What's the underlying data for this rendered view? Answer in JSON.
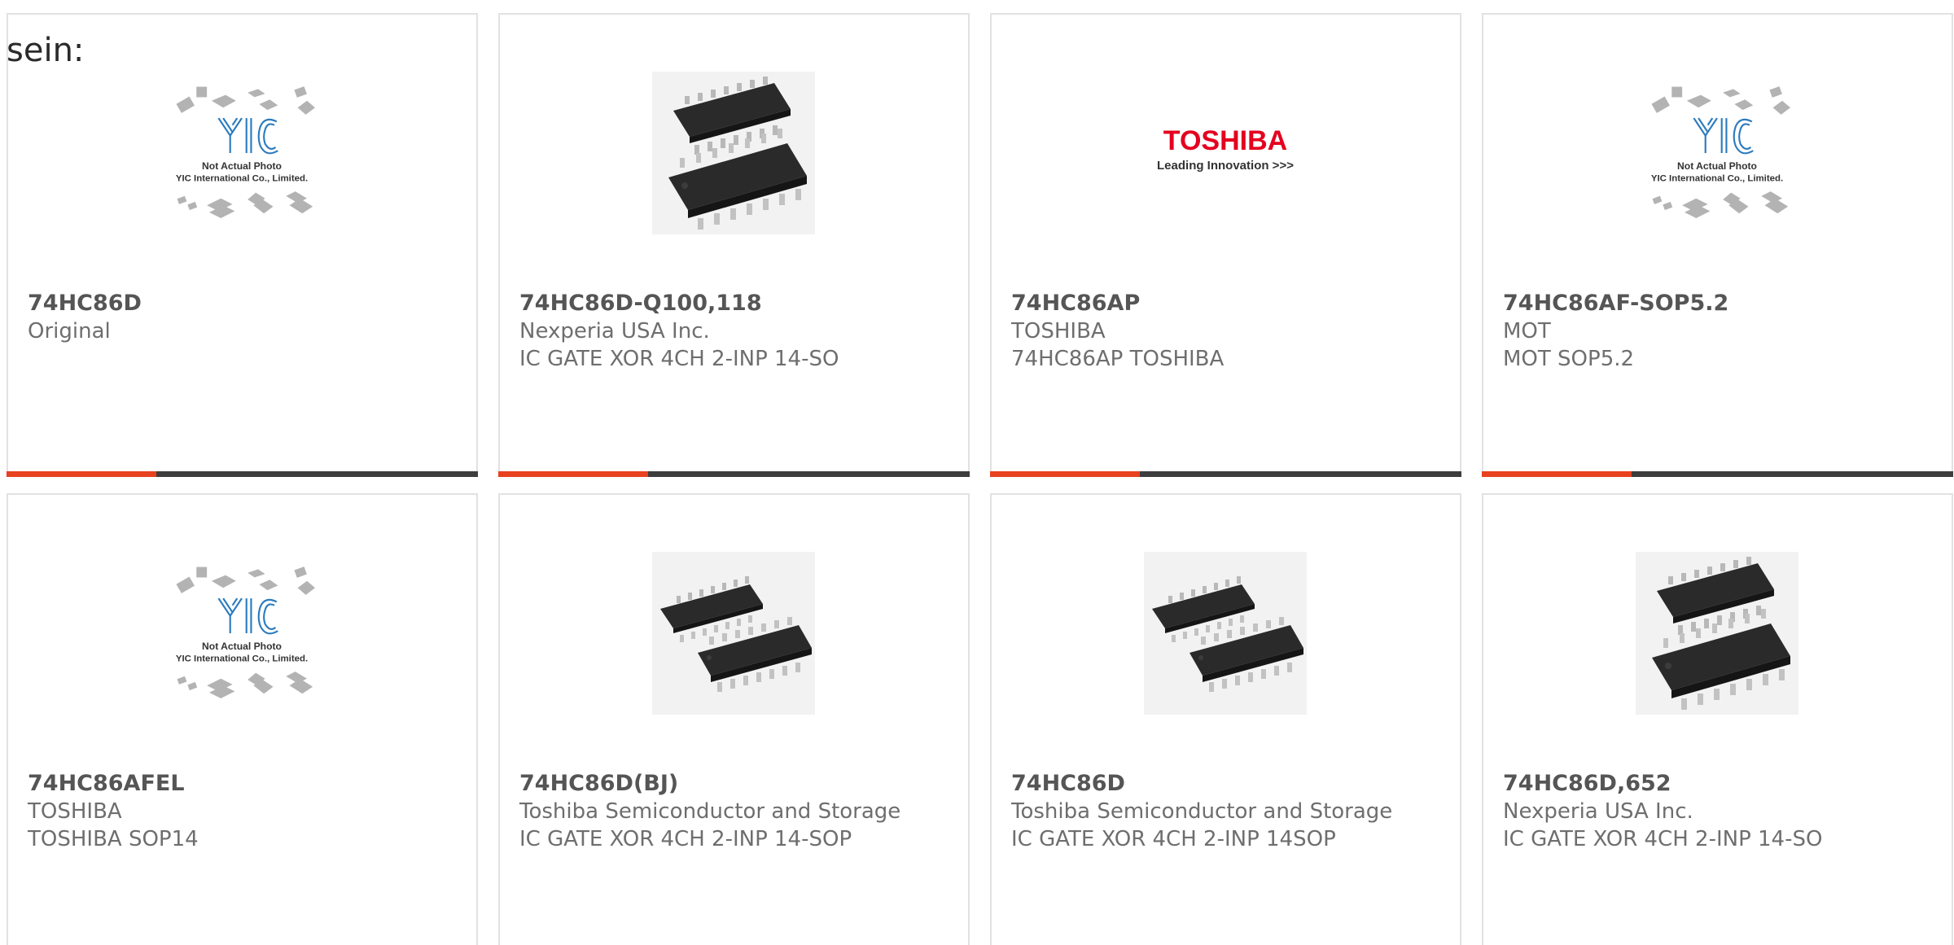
{
  "intro_text": "sein:",
  "colors": {
    "accent": "#e8411f",
    "bar": "#3d3d3d",
    "border": "#e2e2e2",
    "yic_blue": "#2b7bbf",
    "toshiba_red": "#e4001f"
  },
  "products": [
    {
      "part": "74HC86D",
      "maker": "Original",
      "desc": "",
      "image": "yic-not-actual-photo",
      "placeholder_line1": "Not Actual Photo",
      "placeholder_line2": "YIC International Co., Limited."
    },
    {
      "part": "74HC86D-Q100,118",
      "maker": "Nexperia USA Inc.",
      "desc": "IC GATE XOR 4CH 2-INP 14-SO",
      "image": "soic-chip-photo"
    },
    {
      "part": "74HC86AP",
      "maker": "TOSHIBA",
      "desc": "74HC86AP TOSHIBA",
      "image": "toshiba-logo",
      "logo_text": "TOSHIBA",
      "logo_tagline": "Leading Innovation >>>"
    },
    {
      "part": "74HC86AF-SOP5.2",
      "maker": "MOT",
      "desc": "MOT SOP5.2",
      "image": "yic-not-actual-photo",
      "placeholder_line1": "Not Actual Photo",
      "placeholder_line2": "YIC International Co., Limited."
    },
    {
      "part": "74HC86AFEL",
      "maker": "TOSHIBA",
      "desc": "TOSHIBA SOP14",
      "image": "yic-not-actual-photo",
      "placeholder_line1": "Not Actual Photo",
      "placeholder_line2": "YIC International Co., Limited."
    },
    {
      "part": "74HC86D(BJ)",
      "maker": "Toshiba Semiconductor and Storage",
      "desc": "IC GATE XOR 4CH 2-INP 14-SOP",
      "image": "soic-chip-photo"
    },
    {
      "part": "74HC86D",
      "maker": "Toshiba Semiconductor and Storage",
      "desc": "IC GATE XOR 4CH 2-INP 14SOP",
      "image": "soic-chip-photo"
    },
    {
      "part": "74HC86D,652",
      "maker": "Nexperia USA Inc.",
      "desc": "IC GATE XOR 4CH 2-INP 14-SO",
      "image": "soic-chip-photo"
    }
  ]
}
